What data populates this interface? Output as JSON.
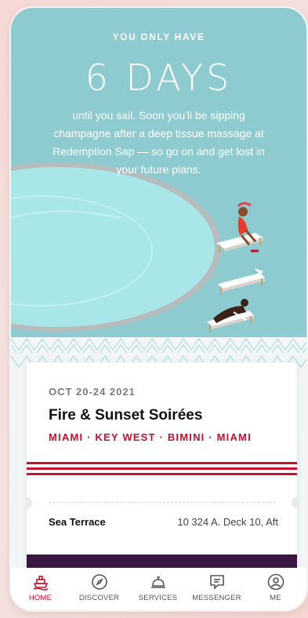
{
  "hero": {
    "kicker": "YOU ONLY HAVE",
    "countdown": "6 DAYS",
    "message": "until you sail. Soon you'll be sipping champagne after a deep tissue massage at Redemption Sap — so go on and get lost in your future plans."
  },
  "voyage": {
    "dates": "OCT 20-24 2021",
    "name": "Fire & Sunset Soirées",
    "route": "MIAMI · KEY WEST · BIMINI · MIAMI",
    "cabin_type": "Sea Terrace",
    "cabin_location": "10 324 A. Deck 10, Aft"
  },
  "tabs": [
    {
      "label": "HOME",
      "icon": "ship-icon",
      "active": true
    },
    {
      "label": "DISCOVER",
      "icon": "compass-icon",
      "active": false
    },
    {
      "label": "SERVICES",
      "icon": "service-bell-icon",
      "active": false
    },
    {
      "label": "MESSENGER",
      "icon": "chat-icon",
      "active": false
    },
    {
      "label": "ME",
      "icon": "person-icon",
      "active": false
    }
  ],
  "colors": {
    "hero_bg": "#8ecbd1",
    "pool": "#a9e6e8",
    "accent_red": "#c8102e",
    "card_band": "#3a1740"
  }
}
